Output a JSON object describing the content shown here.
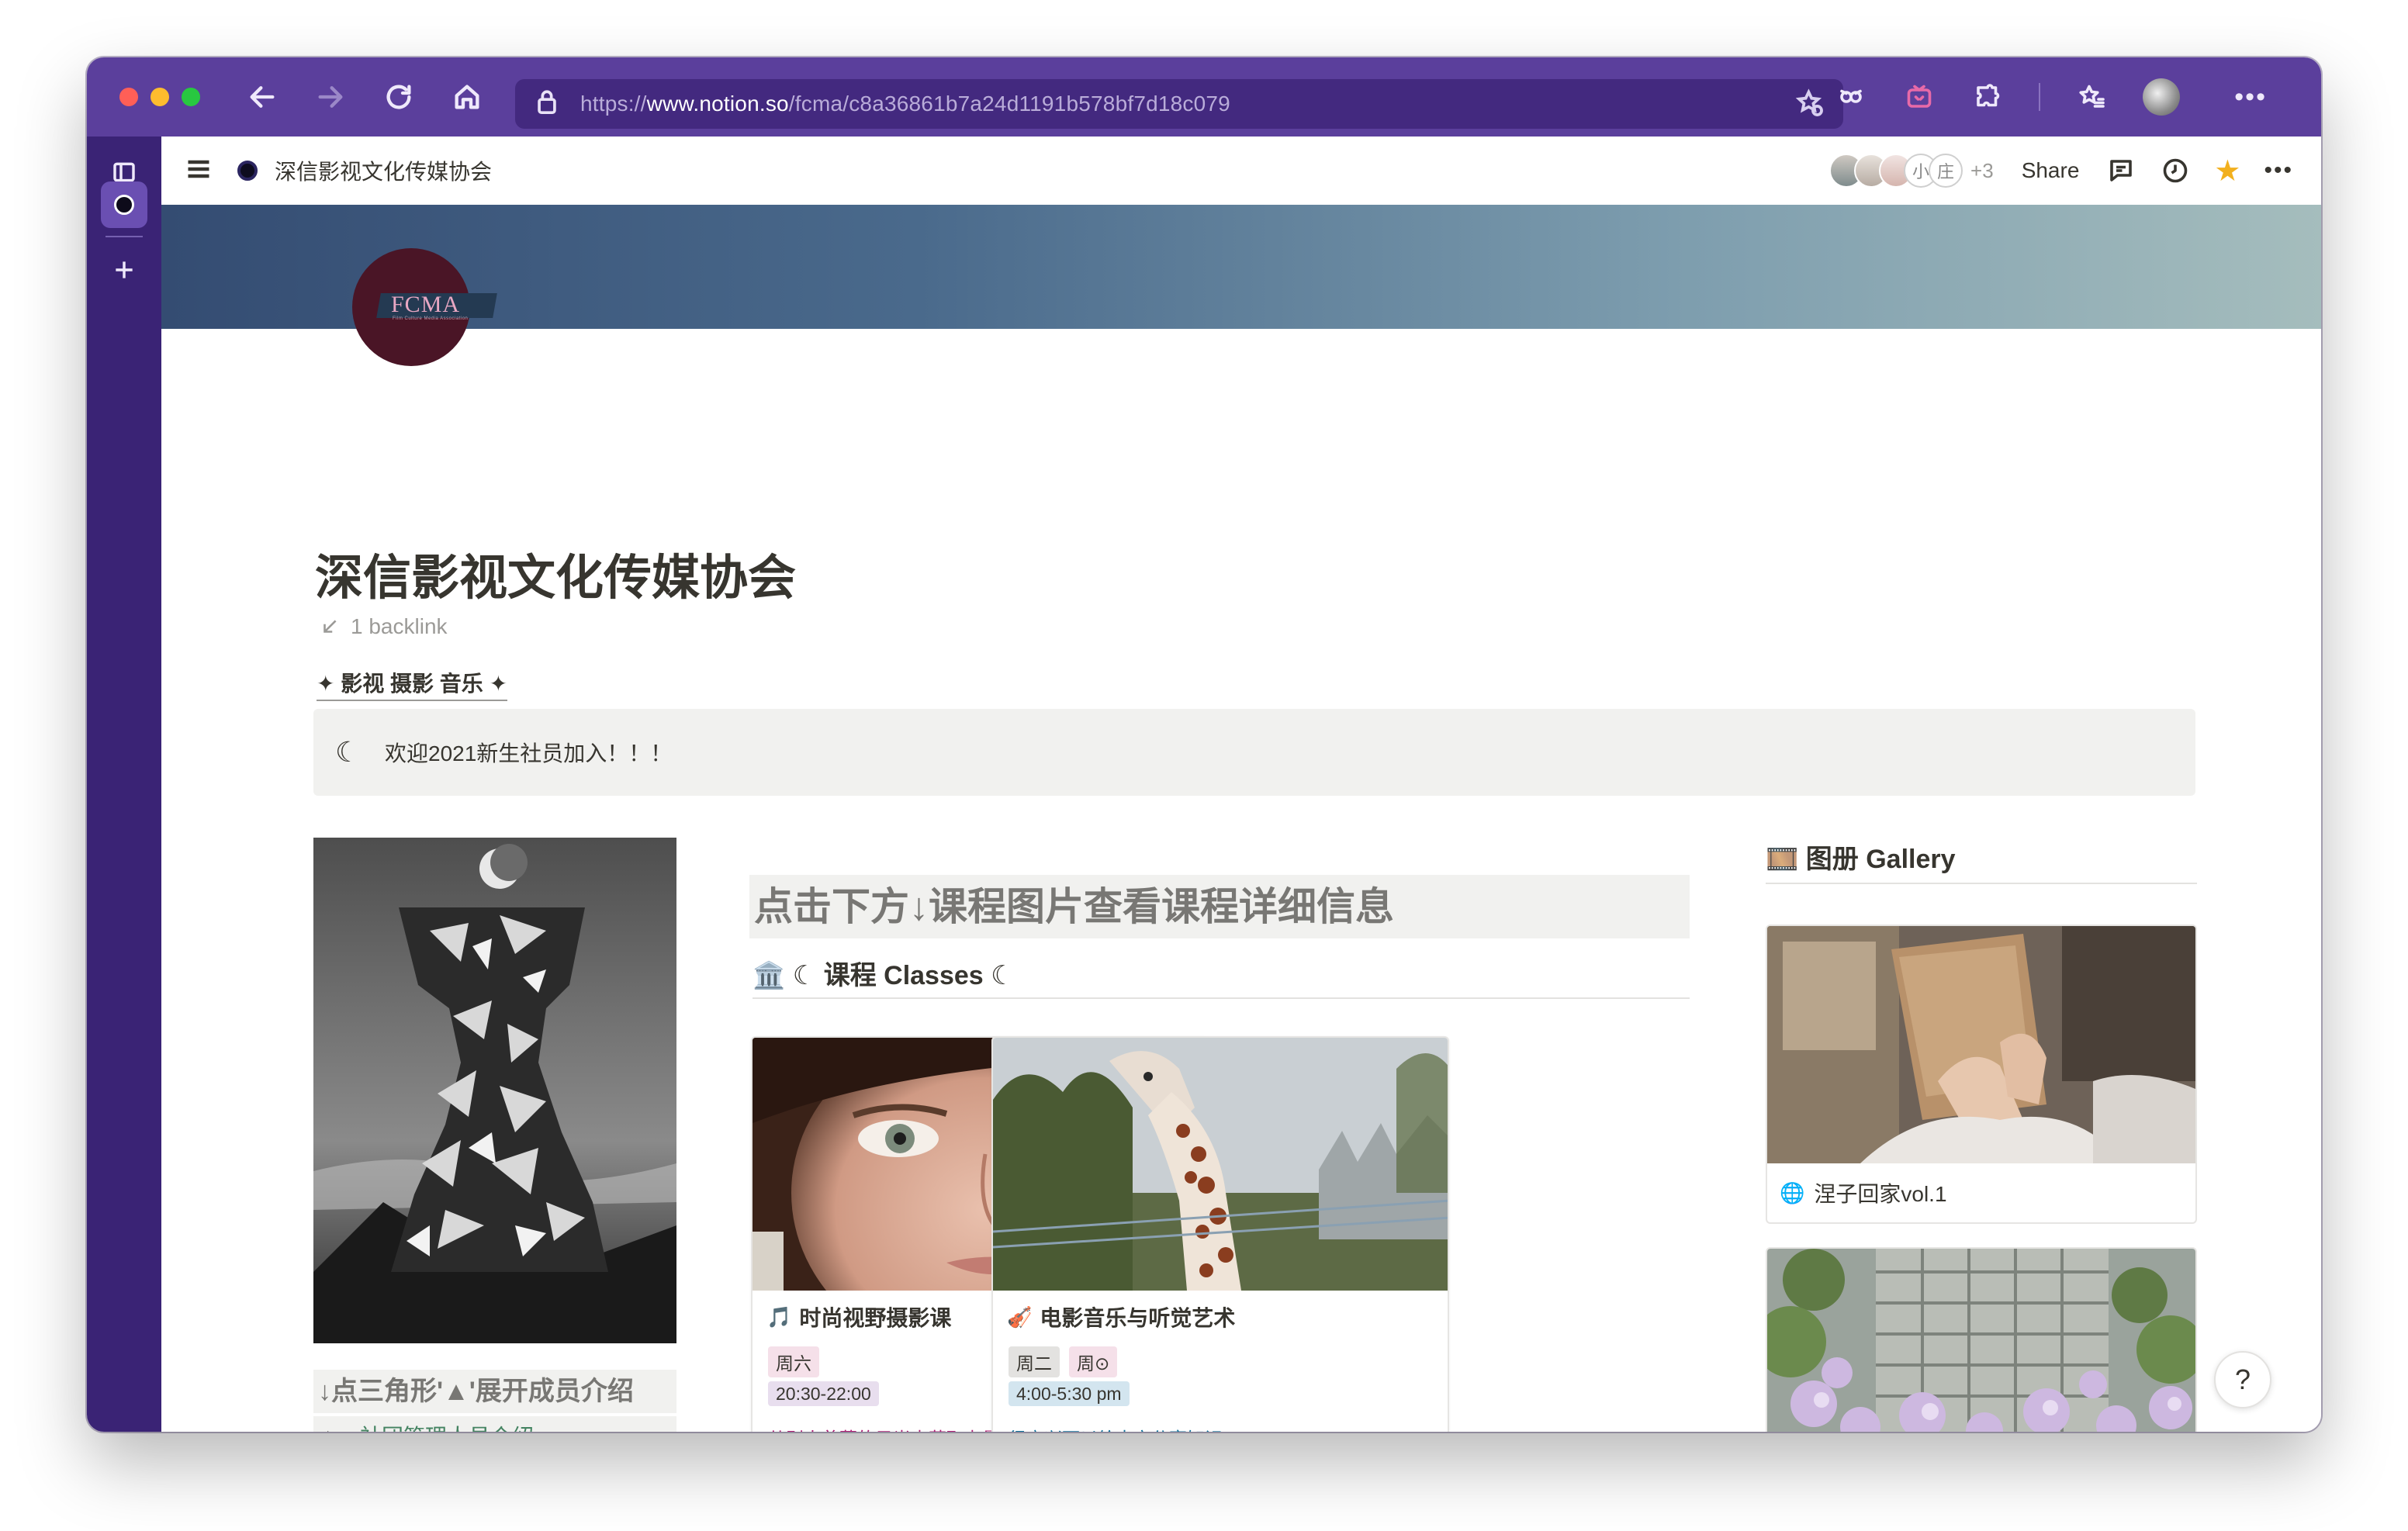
{
  "browser": {
    "url_scheme": "https://",
    "url_host": "www.notion.so",
    "url_path": "/fcma/c8a36861b7a24d1191b578bf7d18c079"
  },
  "topbar": {
    "breadcrumb": "深信影视文化传媒协会",
    "avatar_initial_1": "小",
    "avatar_initial_2": "庄",
    "extra_collaborators": "+3",
    "share_label": "Share"
  },
  "page": {
    "logo_text": "FCMA",
    "logo_subtext": "Film Culture Media Association",
    "title": "深信影视文化传媒协会",
    "backlinks": "1 backlink",
    "tagline": "✦ 影视 摄影 音乐 ✦",
    "callout_icon": "☾",
    "callout_text": "欢迎2021新生社员加入！！！"
  },
  "left": {
    "members_heading": "↓点三角形'▲'展开成员介绍",
    "toggle_label": "社团管理人员介绍"
  },
  "middle": {
    "heading": "点击下方↓课程图片查看课程详细信息",
    "classes_heading": "🏛️ ☾ 课程  Classes ☾",
    "cards": [
      {
        "icon": "🎵",
        "title": "时尚视野摄影课",
        "days": [
          "周六"
        ],
        "time": "20:30-22:00",
        "description": "从别人羡慕的目光中获取力量"
      },
      {
        "icon": "🎻",
        "title": "电影音乐与听觉艺术",
        "days": [
          "周二",
          "周⊙"
        ],
        "time": "4:00-5:30 pm",
        "description": "很高兴可以给大家分享知识"
      }
    ]
  },
  "gallery": {
    "heading": "🎞️ 图册 Gallery",
    "items": [
      {
        "icon": "🌐",
        "title": "涅子回家vol.1"
      }
    ]
  },
  "help_label": "?",
  "colors": {
    "browser_chrome": "#5b3f9c",
    "sidebar_strip": "#3a2375",
    "favorite_star": "#f2b01e",
    "tag_pink": "#f5e0e9",
    "tag_blue": "#d3e5ef",
    "desc_pink": "#ad1a72",
    "desc_blue": "#0b6e99",
    "toggle_green": "#448361"
  }
}
